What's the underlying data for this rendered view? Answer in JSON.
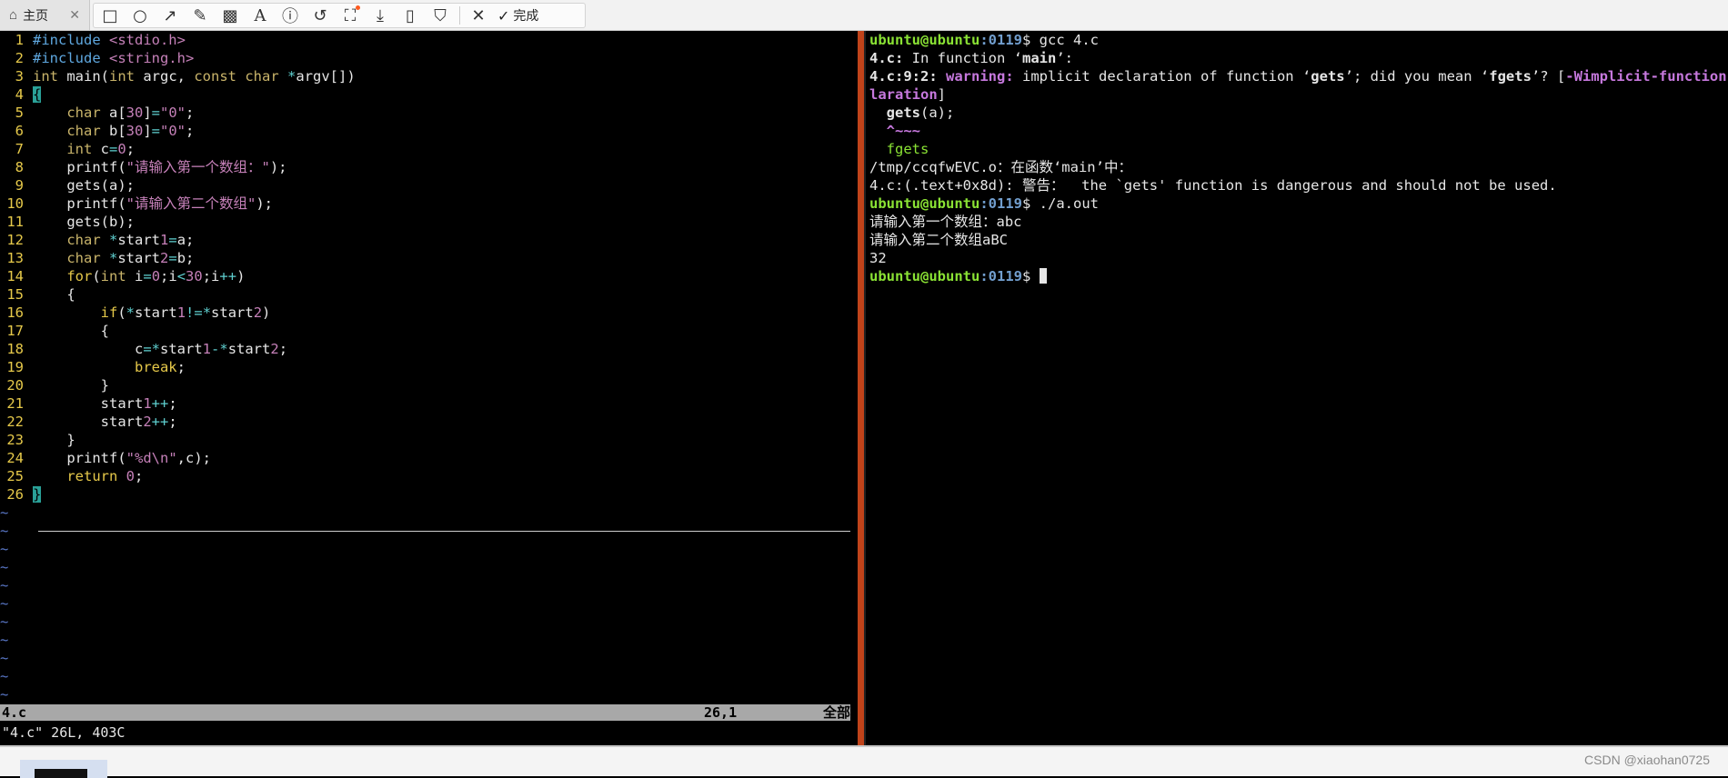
{
  "topbar": {
    "home_tab_label": "主页",
    "done_label": "完成",
    "tools": [
      "rectangle-icon",
      "ellipse-icon",
      "arrow-icon",
      "pen-icon",
      "mosaic-icon",
      "text-icon",
      "number-icon",
      "undo-icon",
      "ocr-icon",
      "download-icon",
      "pin-icon",
      "bookmark-icon",
      "close-icon"
    ]
  },
  "vim": {
    "code": [
      "#include <stdio.h>",
      "#include <string.h>",
      "int main(int argc, const char *argv[])",
      "{",
      "    char a[30]=\"0\";",
      "    char b[30]=\"0\";",
      "    int c=0;",
      "    printf(\"请输入第一个数组：\");",
      "    gets(a);",
      "    printf(\"请输入第二个数组\");",
      "    gets(b);",
      "    char *start1=a;",
      "    char *start2=b;",
      "    for(int i=0;i<30;i++)",
      "    {",
      "        if(*start1!=*start2)",
      "        {",
      "            c=*start1-*start2;",
      "            break;",
      "        }",
      "        start1++;",
      "        start2++;",
      "    }",
      "    printf(\"%d\\n\",c);",
      "    return 0;",
      "}"
    ],
    "tilde": "~",
    "status": {
      "filename": "4.c",
      "position": "26,1",
      "scroll": "全部"
    },
    "message": "\"4.c\" 26L, 403C"
  },
  "terminal": {
    "prompt_user": "ubuntu@ubuntu",
    "prompt_path": ":0119",
    "prompt_sign": "$ ",
    "cmd1": "gcc 4.c",
    "l2_file": "4.c:",
    "l2_rest": " In function ‘",
    "l2_fn": "main",
    "l2_end": "’:",
    "l3_loc": "4.c:9:2: ",
    "l3_warn": "warning: ",
    "l3_msg1": "implicit declaration of function ‘",
    "l3_gets": "gets",
    "l3_msg2": "’; did you mean ‘",
    "l3_fgets": "fgets",
    "l3_msg3": "’? [",
    "l3_flag": "-Wimplicit-function-dec",
    "l4_flag": "laration",
    "l4_end": "]",
    "l5_pre": "  ",
    "l5_gets": "gets",
    "l5_rest": "(a);",
    "l6": "  ^~~~",
    "l7": "  fgets",
    "l8": "/tmp/ccqfwEVC.o：在函数‘main’中：",
    "l9": "4.c:(.text+0x8d): 警告：  the `gets' function is dangerous and should not be used.",
    "cmd2": "./a.out",
    "l11": "请输入第一个数组：abc",
    "l12": "请输入第二个数组aBC",
    "l13": "32"
  },
  "watermark": "CSDN @xiaohan0725"
}
